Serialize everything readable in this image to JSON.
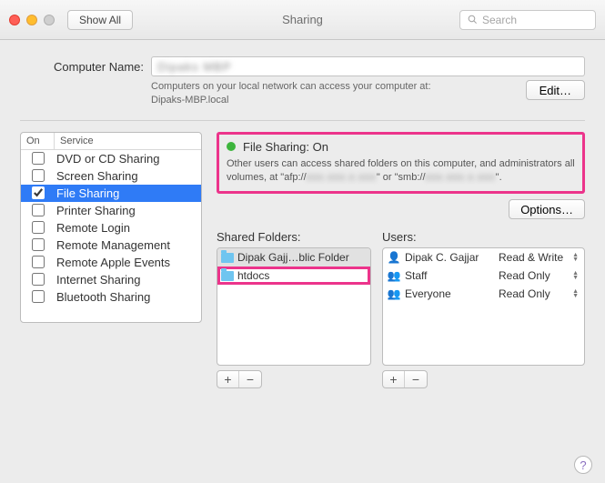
{
  "window": {
    "title": "Sharing",
    "showAll": "Show All",
    "searchPlaceholder": "Search"
  },
  "computerName": {
    "label": "Computer Name:",
    "value": "Dipaks MBP",
    "hint": "Computers on your local network can access your computer at:",
    "hostname": "Dipaks-MBP.local",
    "editLabel": "Edit…"
  },
  "services": {
    "headers": {
      "on": "On",
      "service": "Service"
    },
    "items": [
      {
        "label": "DVD or CD Sharing",
        "checked": false
      },
      {
        "label": "Screen Sharing",
        "checked": false
      },
      {
        "label": "File Sharing",
        "checked": true,
        "selected": true
      },
      {
        "label": "Printer Sharing",
        "checked": false
      },
      {
        "label": "Remote Login",
        "checked": false
      },
      {
        "label": "Remote Management",
        "checked": false
      },
      {
        "label": "Remote Apple Events",
        "checked": false
      },
      {
        "label": "Internet Sharing",
        "checked": false
      },
      {
        "label": "Bluetooth Sharing",
        "checked": false
      }
    ]
  },
  "fileSharing": {
    "statusTitle": "File Sharing: On",
    "statusDescPre": "Other users can access shared folders on this computer, and administrators all volumes, at \"afp://",
    "statusDescMid1": "xxx.xxx.x.xxx",
    "statusDescMid2": "\" or \"smb://",
    "statusDescMid3": "xxx.xxx.x.xxx",
    "statusDescPost": "\".",
    "optionsLabel": "Options…",
    "foldersLabel": "Shared Folders:",
    "usersLabel": "Users:",
    "folders": [
      {
        "label": "Dipak Gajj…blic Folder",
        "selected": true
      },
      {
        "label": "htdocs",
        "highlighted": true
      }
    ],
    "users": [
      {
        "icon": "single",
        "name": "Dipak C. Gajjar",
        "perm": "Read & Write"
      },
      {
        "icon": "double",
        "name": "Staff",
        "perm": "Read Only"
      },
      {
        "icon": "triple",
        "name": "Everyone",
        "perm": "Read Only"
      }
    ],
    "plus": "+",
    "minus": "−"
  },
  "help": "?"
}
